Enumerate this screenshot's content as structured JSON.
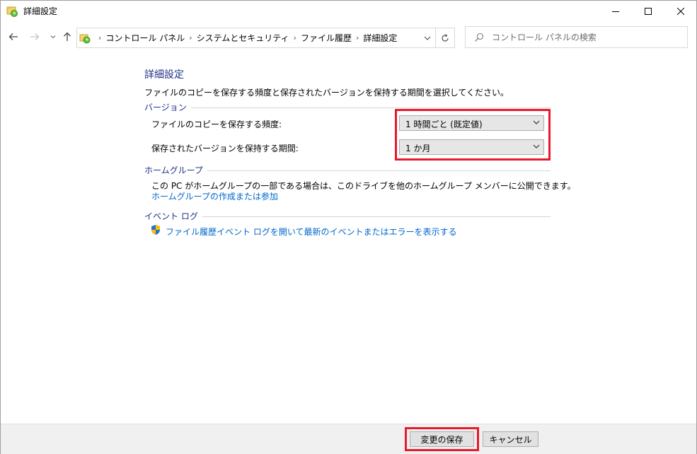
{
  "window": {
    "title": "詳細設定",
    "title_icon": "file-history-icon"
  },
  "nav": {
    "back_icon": "back-arrow-icon",
    "forward_icon": "forward-arrow-icon",
    "recent_icon": "chevron-down-icon",
    "up_icon": "up-arrow-icon"
  },
  "address": {
    "breadcrumbs": [
      "コントロール パネル",
      "システムとセキュリティ",
      "ファイル履歴",
      "詳細設定"
    ]
  },
  "search": {
    "placeholder": "コントロール パネルの検索"
  },
  "main": {
    "title": "詳細設定",
    "description": "ファイルのコピーを保存する頻度と保存されたバージョンを保持する期間を選択してください。",
    "versions": {
      "heading": "バージョン",
      "frequency_label": "ファイルのコピーを保存する頻度:",
      "frequency_value": "1 時間ごと (既定値)",
      "keep_label": "保存されたバージョンを保持する期間:",
      "keep_value": "1 か月"
    },
    "homegroup": {
      "heading": "ホームグループ",
      "text": "この PC がホームグループの一部である場合は、このドライブを他のホームグループ メンバーに公開できます。",
      "link": "ホームグループの作成または参加"
    },
    "eventlog": {
      "heading": "イベント ログ",
      "link": "ファイル履歴イベント ログを開いて最新のイベントまたはエラーを表示する"
    }
  },
  "footer": {
    "save_label": "変更の保存",
    "cancel_label": "キャンセル"
  },
  "colors": {
    "accent_heading": "#1e3287",
    "link": "#0066cc",
    "highlight": "#e8192c"
  }
}
